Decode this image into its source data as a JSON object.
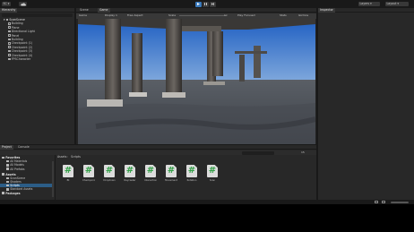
{
  "toolbar": {
    "account_label": "SC",
    "cloud_icon": "cloud-icon",
    "layers_label": "Layers",
    "layout_label": "Layout"
  },
  "hierarchy": {
    "tab": "Hierarchy",
    "scene_name": "ScanScene",
    "items": [
      "Building",
      "Plane",
      "Directional Light",
      "Panel",
      "Building",
      "Checkpoint (1)",
      "Checkpoint (2)",
      "Checkpoint (3)",
      "Checkpoint (4)",
      "FPSCharacter"
    ]
  },
  "viewport": {
    "tabs": [
      "Scene",
      "Game"
    ],
    "game_bar": {
      "display_mode": "Game",
      "display": "Display 1",
      "aspect": "Free Aspect",
      "scale_label": "Scale",
      "scale_value": "1x",
      "play_focus": "Play Focused",
      "stats": "Stats",
      "gizmos": "Gizmos"
    }
  },
  "inspector": {
    "tab": "Inspector"
  },
  "project": {
    "tabs": [
      "Project",
      "Console"
    ],
    "breadcrumb": [
      "Assets",
      "Scripts"
    ],
    "item_count": "15",
    "tree": [
      {
        "label": "Favorites",
        "bold": true
      },
      {
        "label": "All Materials"
      },
      {
        "label": "All Models"
      },
      {
        "label": "All Prefabs"
      },
      {
        "label": "Assets",
        "bold": true
      },
      {
        "label": "ScanScene"
      },
      {
        "label": "Shaders"
      },
      {
        "label": "Scripts",
        "selected": true
      },
      {
        "label": "Standard Assets"
      },
      {
        "label": "Packages",
        "bold": true
      }
    ],
    "assets": [
      "Bt",
      "Checkpoint",
      "Dropdown",
      "Raycaster",
      "Interaction",
      "Movement",
      "Rotation",
      "Scan"
    ]
  },
  "colors": {
    "accent": "#3a79bb",
    "panel": "#282828",
    "background": "#191919",
    "script_hash": "#2f9e44"
  }
}
